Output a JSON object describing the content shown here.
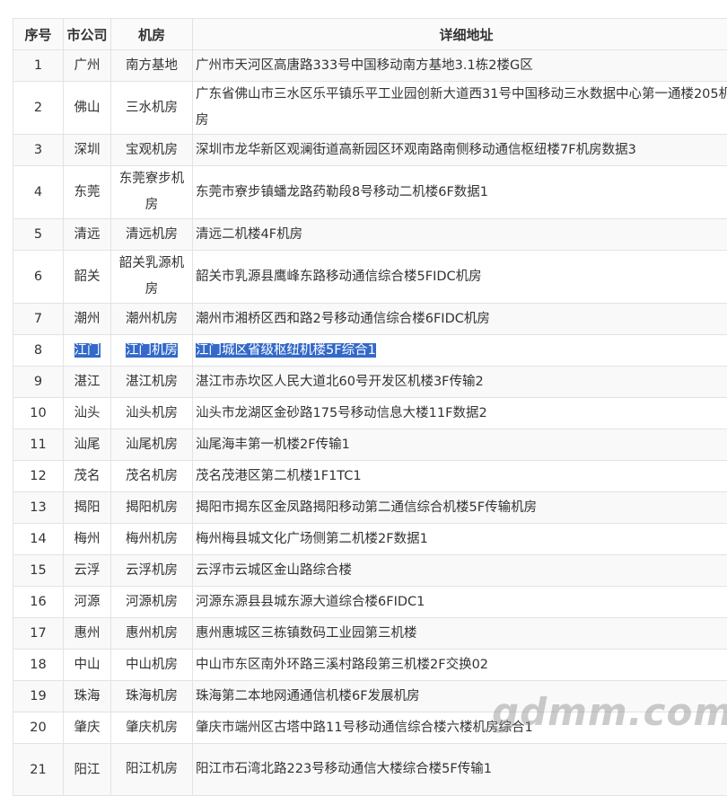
{
  "table": {
    "headers": [
      "序号",
      "市公司",
      "机房",
      "详细地址"
    ],
    "rows": [
      {
        "num": "1",
        "city": "广州",
        "room": "南方基地",
        "address": "广州市天河区高唐路333号中国移动南方基地3.1栋2楼G区"
      },
      {
        "num": "2",
        "city": "佛山",
        "room": "三水机房",
        "address": "广东省佛山市三水区乐平镇乐平工业园创新大道西31号中国移动三水数据中心第一通楼205机房"
      },
      {
        "num": "3",
        "city": "深圳",
        "room": "宝观机房",
        "address": "深圳市龙华新区观澜街道高新园区环观南路南侧移动通信枢纽楼7F机房数据3"
      },
      {
        "num": "4",
        "city": "东莞",
        "room": "东莞寮步机房",
        "address": "东莞市寮步镇蟠龙路药勒段8号移动二机楼6F数据1"
      },
      {
        "num": "5",
        "city": "清远",
        "room": "清远机房",
        "address": "清远二机楼4F机房"
      },
      {
        "num": "6",
        "city": "韶关",
        "room": "韶关乳源机房",
        "address": "韶关市乳源县鹰峰东路移动通信综合楼5FIDC机房"
      },
      {
        "num": "7",
        "city": "潮州",
        "room": "潮州机房",
        "address": "潮州市湘桥区西和路2号移动通信综合楼6FIDC机房"
      },
      {
        "num": "8",
        "city": "江门",
        "room": "江门机房",
        "address": "江门城区省级枢纽机楼5F综合1"
      },
      {
        "num": "9",
        "city": "湛江",
        "room": "湛江机房",
        "address": "湛江市赤坎区人民大道北60号开发区机楼3F传输2"
      },
      {
        "num": "10",
        "city": "汕头",
        "room": "汕头机房",
        "address": "汕头市龙湖区金砂路175号移动信息大楼11F数据2"
      },
      {
        "num": "11",
        "city": "汕尾",
        "room": "汕尾机房",
        "address": "汕尾海丰第一机楼2F传输1"
      },
      {
        "num": "12",
        "city": "茂名",
        "room": "茂名机房",
        "address": "茂名茂港区第二机楼1F1TC1"
      },
      {
        "num": "13",
        "city": "揭阳",
        "room": "揭阳机房",
        "address": "揭阳市揭东区金凤路揭阳移动第二通信综合机楼5F传输机房"
      },
      {
        "num": "14",
        "city": "梅州",
        "room": "梅州机房",
        "address": "梅州梅县城文化广场侧第二机楼2F数据1"
      },
      {
        "num": "15",
        "city": "云浮",
        "room": "云浮机房",
        "address": "云浮市云城区金山路综合楼"
      },
      {
        "num": "16",
        "city": "河源",
        "room": "河源机房",
        "address": "河源东源县县城东源大道综合楼6FIDC1"
      },
      {
        "num": "17",
        "city": "惠州",
        "room": "惠州机房",
        "address": "惠州惠城区三栋镇数码工业园第三机楼"
      },
      {
        "num": "18",
        "city": "中山",
        "room": "中山机房",
        "address": "中山市东区南外环路三溪村路段第三机楼2F交换02"
      },
      {
        "num": "19",
        "city": "珠海",
        "room": "珠海机房",
        "address": "珠海第二本地网通通信机楼6F发展机房"
      },
      {
        "num": "20",
        "city": "肇庆",
        "room": "肇庆机房",
        "address": "肇庆市端州区古塔中路11号移动通信综合楼六楼机房综合1"
      },
      {
        "num": "21",
        "city": "阳江",
        "room": "阳江机房",
        "address": "阳江市石湾北路223号移动通信大楼综合楼5F传输1"
      }
    ]
  },
  "selected_row": "8",
  "watermark": "gdmm.com"
}
